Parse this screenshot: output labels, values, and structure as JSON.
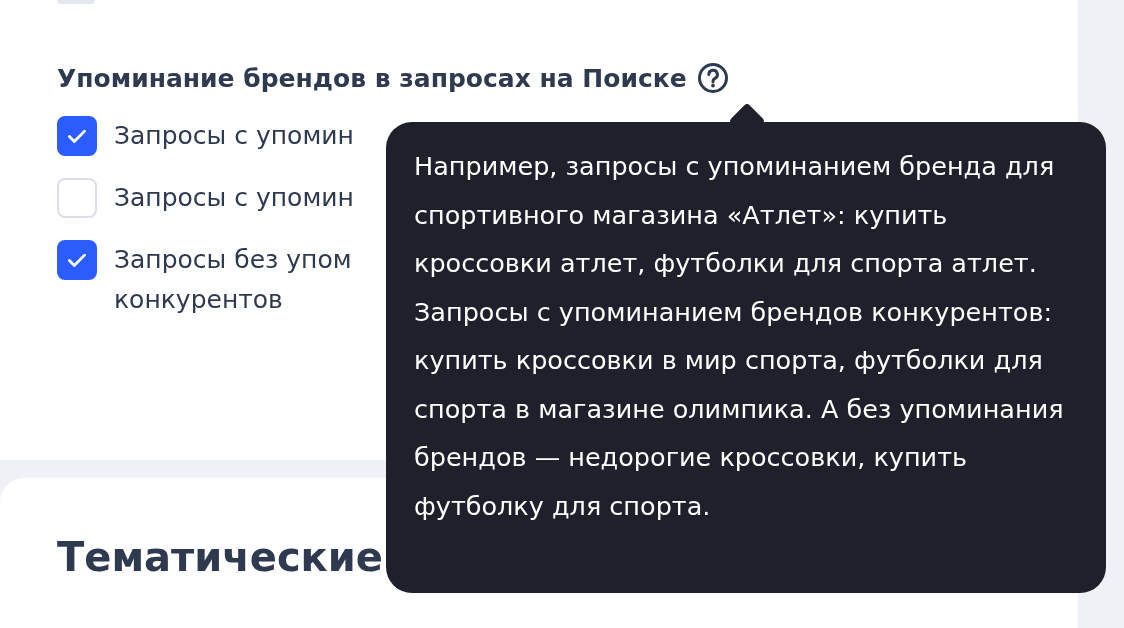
{
  "partial_checkbox": {
    "checked": false
  },
  "brand_section": {
    "title": "Упоминание брендов в запросах на Поиске",
    "options": [
      {
        "lines": [
          "Запросы с упомин"
        ],
        "checked": true
      },
      {
        "lines": [
          "Запросы с упомин"
        ],
        "checked": false
      },
      {
        "lines": [
          "Запросы без упом",
          "конкурентов"
        ],
        "checked": true
      }
    ]
  },
  "tooltip": {
    "text": "Например, запросы с упоминанием бренда для спортивного магазина «Атлет»: купить кроссовки атлет, футболки для спорта атлет. Запросы с упоминанием брендов конкурентов: купить кроссовки в мир спорта, футболки для спорта в магазине олимпика. А без упоминания брендов — недорогие кроссовки, купить футболку для спорта."
  },
  "next_section": {
    "title": "Тематические"
  }
}
